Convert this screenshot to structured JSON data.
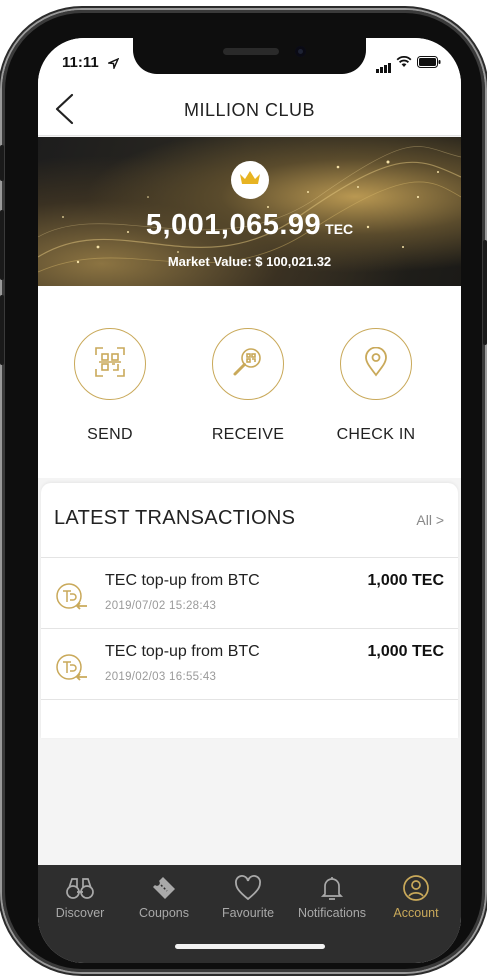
{
  "status_bar": {
    "time": "11:11"
  },
  "navbar": {
    "title": "MILLION CLUB"
  },
  "banner": {
    "balance": "5,001,065.99",
    "unit": "TEC",
    "market_value": "Market Value: $ 100,021.32"
  },
  "actions": [
    {
      "label": "SEND",
      "icon": "qr-scan-icon"
    },
    {
      "label": "RECEIVE",
      "icon": "search-qr-icon"
    },
    {
      "label": "CHECK IN",
      "icon": "location-pin-icon"
    }
  ],
  "transactions": {
    "title": "LATEST TRANSACTIONS",
    "all_label": "All >",
    "items": [
      {
        "name": "TEC top-up from BTC",
        "date": "2019/07/02 15:28:43",
        "amount": "1,000 TEC"
      },
      {
        "name": "TEC top-up from BTC",
        "date": "2019/02/03 16:55:43",
        "amount": "1,000 TEC"
      }
    ]
  },
  "tabbar": {
    "items": [
      {
        "label": "Discover",
        "icon": "binoculars-icon",
        "active": false
      },
      {
        "label": "Coupons",
        "icon": "ticket-icon",
        "active": false
      },
      {
        "label": "Favourite",
        "icon": "heart-icon",
        "active": false
      },
      {
        "label": "Notifications",
        "icon": "bell-icon",
        "active": false
      },
      {
        "label": "Account",
        "icon": "user-icon",
        "active": true
      }
    ]
  },
  "colors": {
    "accent": "#c9a95a",
    "tabbar_bg": "#2e2e2e",
    "banner_dark": "#1d1d1d"
  }
}
